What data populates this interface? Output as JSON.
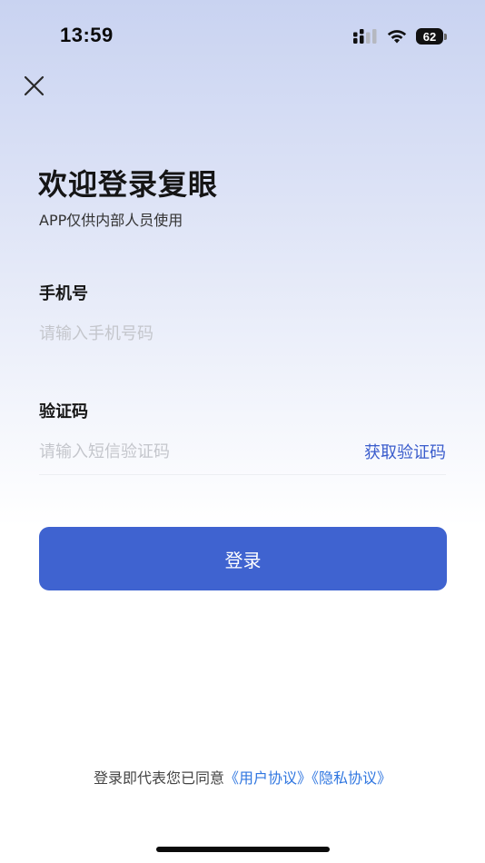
{
  "status_bar": {
    "time": "13:59",
    "battery_level": "62",
    "icons": [
      "cellular-signal-icon",
      "wifi-icon",
      "battery-icon"
    ]
  },
  "header": {
    "close_icon": "close-icon",
    "title": "欢迎登录复眼",
    "subtitle": "APP仅供内部人员使用"
  },
  "form": {
    "phone": {
      "label": "手机号",
      "value": "",
      "placeholder": "请输入手机号码"
    },
    "code": {
      "label": "验证码",
      "value": "",
      "placeholder": "请输入短信验证码",
      "get_code_label": "获取验证码"
    },
    "login_label": "登录"
  },
  "agreement": {
    "prefix": "登录即代表您已同意",
    "user_agreement": "《用户协议》",
    "privacy_policy": "《隐私协议》"
  },
  "colors": {
    "accent": "#3f63d0",
    "link": "#2f76e0",
    "get_code": "#3a5ccc",
    "placeholder": "#c4c6cc"
  }
}
